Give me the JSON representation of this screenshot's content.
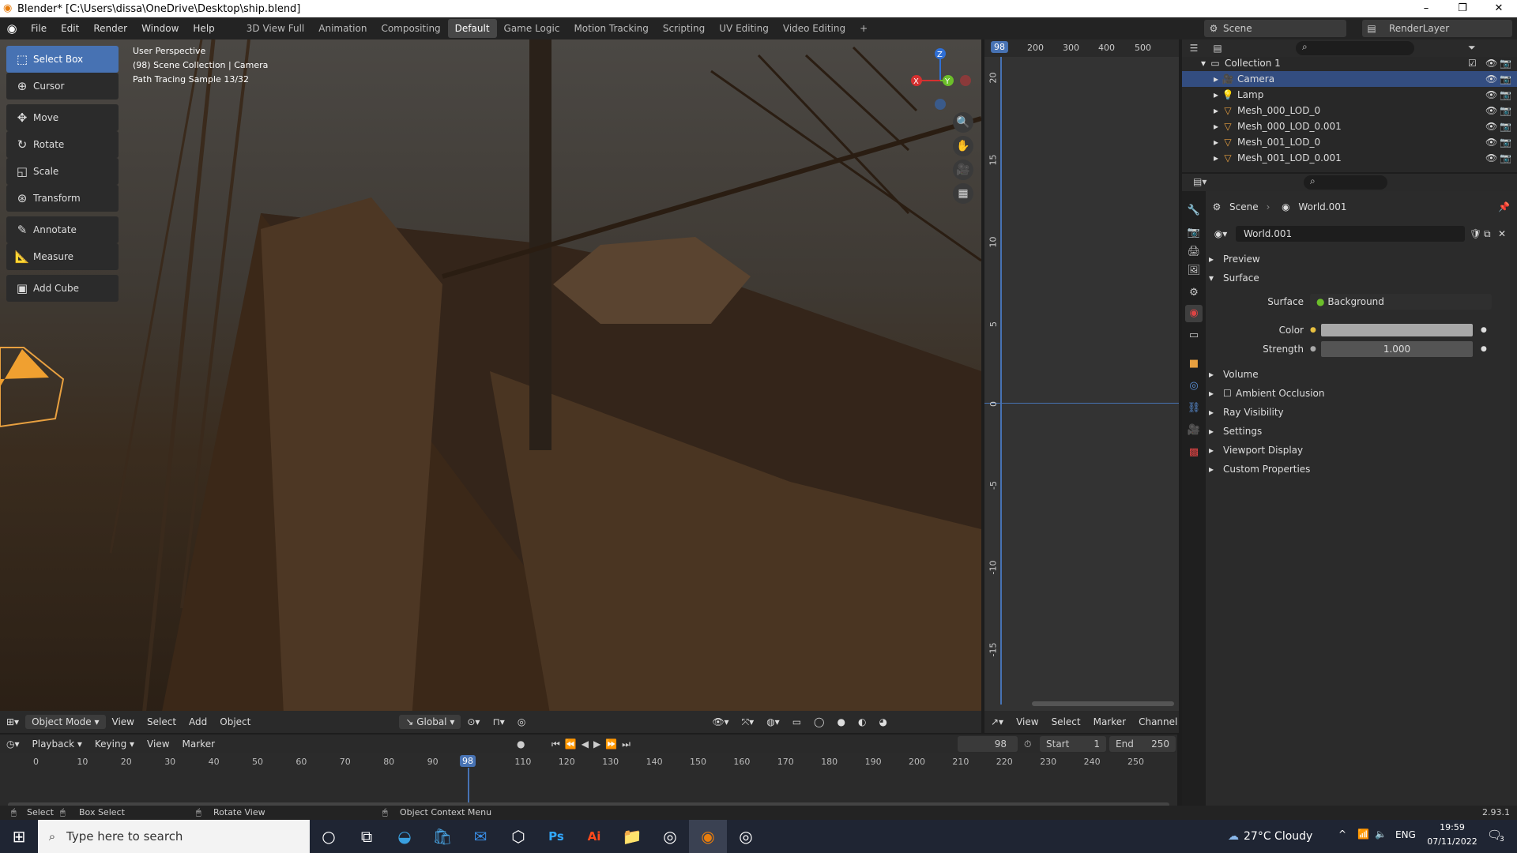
{
  "window": {
    "title": "Blender* [C:\\Users\\dissa\\OneDrive\\Desktop\\ship.blend]"
  },
  "menu": [
    "File",
    "Edit",
    "Render",
    "Window",
    "Help"
  ],
  "workspaces": [
    "3D View Full",
    "Animation",
    "Compositing",
    "Default",
    "Game Logic",
    "Motion Tracking",
    "Scripting",
    "UV Editing",
    "Video Editing"
  ],
  "active_workspace": "Default",
  "scene": {
    "name": "Scene",
    "render_layer": "RenderLayer"
  },
  "tools": [
    {
      "label": "Select Box",
      "icon": "select-box-icon"
    },
    {
      "label": "Cursor",
      "icon": "cursor-icon"
    },
    {
      "label": "Move",
      "icon": "move-icon"
    },
    {
      "label": "Rotate",
      "icon": "rotate-icon"
    },
    {
      "label": "Scale",
      "icon": "scale-icon"
    },
    {
      "label": "Transform",
      "icon": "transform-icon"
    },
    {
      "label": "Annotate",
      "icon": "annotate-icon"
    },
    {
      "label": "Measure",
      "icon": "measure-icon"
    },
    {
      "label": "Add Cube",
      "icon": "add-cube-icon"
    }
  ],
  "viewport": {
    "info1": "User Perspective",
    "info2": "(98) Scene Collection | Camera",
    "info3": "Path Tracing Sample 13/32",
    "mode": "Object Mode",
    "menus": [
      "View",
      "Select",
      "Add",
      "Object"
    ],
    "orientation": "Global"
  },
  "graph": {
    "frame": "98",
    "x_ticks": [
      "200",
      "300",
      "400",
      "500"
    ],
    "y_ticks": [
      "20",
      "15",
      "10",
      "5",
      "0",
      "-5",
      "-10",
      "-15"
    ],
    "menus": [
      "View",
      "Select",
      "Marker",
      "Channel"
    ]
  },
  "outliner": {
    "collection": "Collection 1",
    "items": [
      {
        "name": "Camera",
        "selected": true
      },
      {
        "name": "Lamp",
        "selected": false
      },
      {
        "name": "Mesh_000_LOD_0",
        "selected": false
      },
      {
        "name": "Mesh_000_LOD_0.001",
        "selected": false
      },
      {
        "name": "Mesh_001_LOD_0",
        "selected": false
      },
      {
        "name": "Mesh_001_LOD_0.001",
        "selected": false
      }
    ]
  },
  "props": {
    "crumb_scene": "Scene",
    "crumb_world": "World.001",
    "world_name": "World.001",
    "preview": "Preview",
    "surface_panel": "Surface",
    "surface_label": "Surface",
    "surface_value": "Background",
    "color_label": "Color",
    "strength_label": "Strength",
    "strength_value": "1.000",
    "panels": [
      "Volume",
      "Ambient Occlusion",
      "Ray Visibility",
      "Settings",
      "Viewport Display",
      "Custom Properties"
    ]
  },
  "timeline": {
    "menus": [
      "Playback",
      "Keying",
      "View",
      "Marker"
    ],
    "current_frame": "98",
    "start_label": "Start",
    "start": "1",
    "end_label": "End",
    "end": "250",
    "ticks": [
      "0",
      "10",
      "20",
      "30",
      "40",
      "50",
      "60",
      "70",
      "80",
      "90",
      "110",
      "120",
      "130",
      "140",
      "150",
      "160",
      "170",
      "180",
      "190",
      "200",
      "210",
      "220",
      "230",
      "240",
      "250"
    ]
  },
  "status": {
    "select": "Select",
    "box_select": "Box Select",
    "rotate_view": "Rotate View",
    "context_menu": "Object Context Menu",
    "version": "2.93.1"
  },
  "taskbar": {
    "search_placeholder": "Type here to search",
    "weather": "27°C Cloudy",
    "lang": "ENG",
    "time": "19:59",
    "date": "07/11/2022",
    "notif": "3"
  }
}
